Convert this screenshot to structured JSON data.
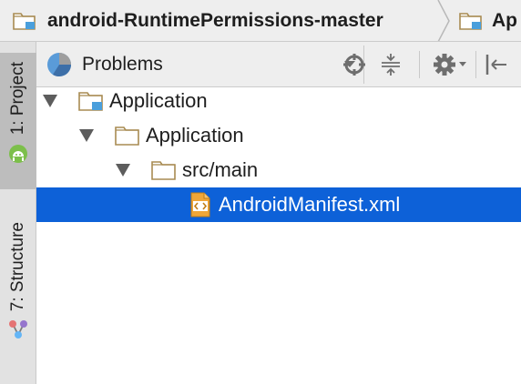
{
  "breadcrumb": {
    "items": [
      {
        "label": "android-RuntimePermissions-master",
        "icon": "folder-module-icon"
      },
      {
        "label": "Ap",
        "icon": "folder-module-icon"
      }
    ]
  },
  "sidebar": {
    "tabs": [
      {
        "label": "1: Project",
        "active": true,
        "icon": "android-icon"
      },
      {
        "label": "7: Structure",
        "active": false,
        "icon": "structure-icon"
      }
    ]
  },
  "toolbar": {
    "scope_label": "Problems",
    "scope_icon": "pie-chart-icon",
    "actions": [
      "target-icon",
      "collapse-all-icon",
      "gear-icon",
      "hide-panel-icon"
    ]
  },
  "tree": {
    "rows": [
      {
        "label": "Application",
        "level": 0,
        "expanded": true,
        "icon": "folder-module-icon"
      },
      {
        "label": "Application",
        "level": 1,
        "expanded": true,
        "icon": "folder-icon"
      },
      {
        "label": "src/main",
        "level": 2,
        "expanded": true,
        "icon": "folder-icon"
      },
      {
        "label": "AndroidManifest.xml",
        "level": 3,
        "selected": true,
        "icon": "xml-file-icon"
      }
    ]
  },
  "colors": {
    "selection": "#0d61d8",
    "folder": "#c9a76a",
    "module_badge": "#4a9fdc",
    "sidebar_active": "#bdbdbd"
  }
}
